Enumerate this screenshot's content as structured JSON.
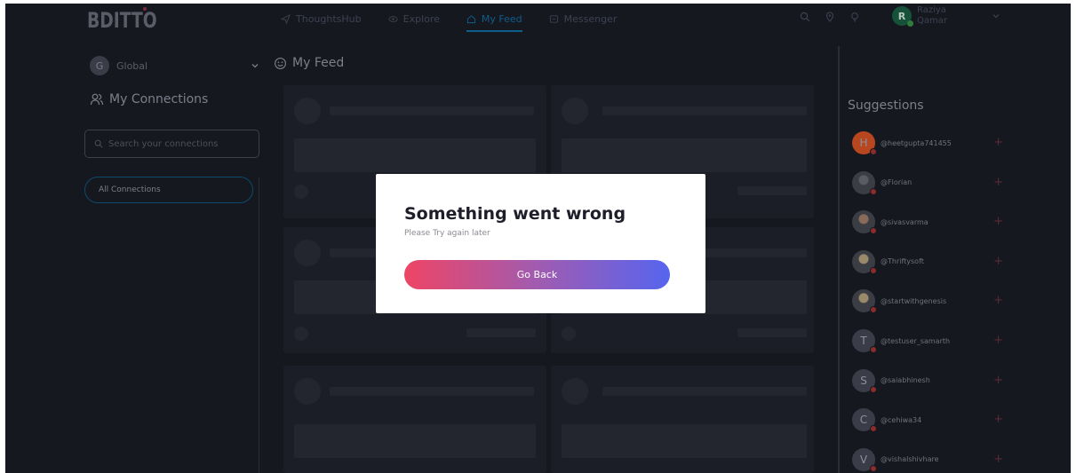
{
  "app": {
    "logo": "BDITTO"
  },
  "nav": {
    "items": [
      {
        "label": "ThoughtsHub",
        "icon": "send-icon",
        "active": false
      },
      {
        "label": "Explore",
        "icon": "eye-icon",
        "active": false
      },
      {
        "label": "My Feed",
        "icon": "home-icon",
        "active": true
      },
      {
        "label": "Messenger",
        "icon": "message-icon",
        "active": false
      }
    ]
  },
  "header": {
    "icons": [
      "search-icon",
      "location-pin-icon",
      "bulb-icon"
    ],
    "user": {
      "initial": "R",
      "name": "Raziya Qamar"
    }
  },
  "sidebar": {
    "space": {
      "initial": "G",
      "label": "Global"
    },
    "connections_title": "My Connections",
    "search_placeholder": "Search your connections",
    "all_connections_label": "All Connections"
  },
  "feed": {
    "title": "My Feed"
  },
  "suggestions": {
    "title": "Suggestions",
    "items": [
      {
        "handle": "@heetgupta741455",
        "initial": "H",
        "avatar_color": "#b8471f",
        "photo": false
      },
      {
        "handle": "@Florian",
        "initial": "",
        "avatar_color": "#5a5c62",
        "photo": true
      },
      {
        "handle": "@sivasvarma",
        "initial": "",
        "avatar_color": "#8a6a58",
        "photo": true
      },
      {
        "handle": "@Thriftysoft",
        "initial": "",
        "avatar_color": "#9a8a6a",
        "photo": true
      },
      {
        "handle": "@startwithgenesis",
        "initial": "",
        "avatar_color": "#9a8a6a",
        "photo": true
      },
      {
        "handle": "@testuser_samarth",
        "initial": "T",
        "avatar_color": "#3a3d47",
        "photo": false
      },
      {
        "handle": "@saiabhinesh",
        "initial": "S",
        "avatar_color": "#3a3d47",
        "photo": false
      },
      {
        "handle": "@cehiwa34",
        "initial": "C",
        "avatar_color": "#3a3d47",
        "photo": false
      },
      {
        "handle": "@vishalshivhare",
        "initial": "V",
        "avatar_color": "#3a3d47",
        "photo": false
      }
    ]
  },
  "modal": {
    "title": "Something went wrong",
    "subtitle": "Please Try again later",
    "button_label": "Go Back"
  },
  "colors": {
    "background": "#161820",
    "accent": "#0e5d8a",
    "button_gradient_start": "#ee4565",
    "button_gradient_end": "#5665ef"
  }
}
